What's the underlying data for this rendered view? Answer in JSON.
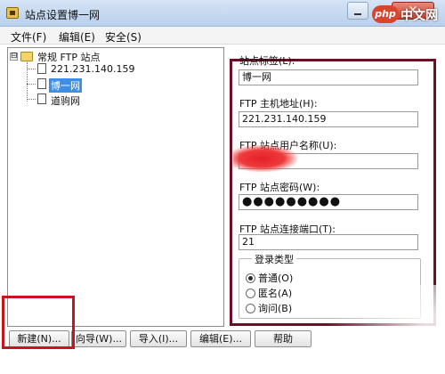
{
  "window": {
    "title": "站点设置博一网",
    "close_label": "×"
  },
  "watermark": {
    "logo": "php",
    "text": "中文网"
  },
  "menu": [
    "文件(F)",
    "编辑(E)",
    "安全(S)"
  ],
  "tree": {
    "expander": "⊟",
    "root": "常规 FTP 站点",
    "items": [
      {
        "label": "221.231.140.159",
        "selected": false
      },
      {
        "label": "博一网",
        "selected": true
      },
      {
        "label": "道驹网",
        "selected": false
      }
    ]
  },
  "fields": {
    "site_label": {
      "label": "站点标签(L):",
      "value": "博一网"
    },
    "host": {
      "label": "FTP 主机地址(H):",
      "value": "221.231.140.159"
    },
    "user": {
      "label": "FTP 站点用户名称(U):",
      "value": ""
    },
    "password": {
      "label": "FTP 站点密码(W):",
      "value": "●●●●●●●●●"
    },
    "port": {
      "label": "FTP 站点连接端口(T):",
      "value": "21"
    }
  },
  "login_type": {
    "title": "登录类型",
    "options": [
      {
        "label": "普通(O)",
        "checked": true
      },
      {
        "label": "匿名(A)",
        "checked": false
      },
      {
        "label": "询问(B)",
        "checked": false
      }
    ]
  },
  "buttons": {
    "new": "新建(N)...",
    "wizard": "向导(W)...",
    "import": "导入(I)...",
    "edit": "编辑(E)...",
    "help": "帮助"
  }
}
